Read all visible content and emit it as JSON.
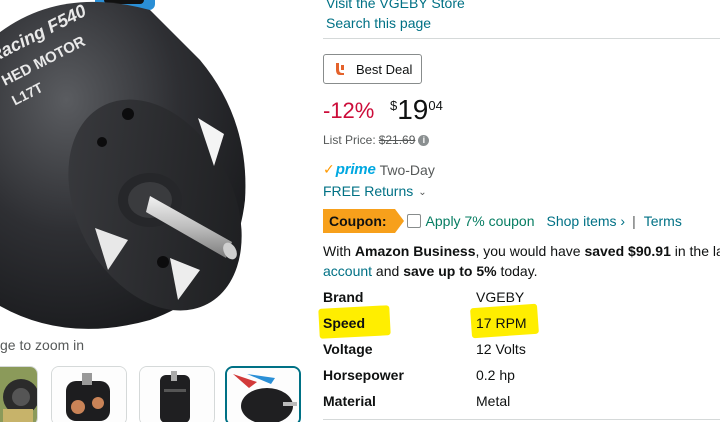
{
  "gallery": {
    "zoom_hint": "ge to zoom in",
    "thumbnails": [
      "thumb-action-shot",
      "thumb-motor-copper",
      "thumb-motor-side",
      "thumb-motor-front"
    ],
    "selected_thumbnail": 3
  },
  "store": {
    "visit_label": "Visit the VGEBY Store",
    "search_label": "Search this page"
  },
  "badge": {
    "best_deal": "Best Deal",
    "icon": "flame-icon"
  },
  "pricing": {
    "discount": "-12%",
    "currency": "$",
    "whole": "19",
    "fraction": "04",
    "list_price_label": "List Price:",
    "list_price_value": "$21.69",
    "info_icon": "info-icon"
  },
  "delivery": {
    "prime_check": "✓",
    "prime_label": "prime",
    "prime_speed": "Two-Day",
    "returns_label": "FREE Returns",
    "returns_icon": "chevron-down-icon"
  },
  "coupon": {
    "tag": "Coupon:",
    "apply_text": "Apply 7% coupon",
    "shop_items": "Shop items ›",
    "separator": "|",
    "terms": "Terms"
  },
  "business": {
    "prefix": "With ",
    "brand": "Amazon Business",
    "middle": ", you would have ",
    "saved": "saved $90.91",
    "suffix": " in the la",
    "account": "account",
    "and_text": " and ",
    "save_up": "save up to 5%",
    "today": " today."
  },
  "specs": [
    {
      "key": "Brand",
      "value": "VGEBY",
      "highlighted": false
    },
    {
      "key": "Speed",
      "value": "17 RPM",
      "highlighted": true
    },
    {
      "key": "Voltage",
      "value": "12 Volts",
      "highlighted": false
    },
    {
      "key": "Horsepower",
      "value": "0.2 hp",
      "highlighted": false
    },
    {
      "key": "Material",
      "value": "Metal",
      "highlighted": false
    }
  ],
  "colors": {
    "link": "#007185",
    "discount": "#cc0c39",
    "coupon_tag": "#f7a01b",
    "coupon_text": "#067d62",
    "prime": "#00a8e1",
    "highlight": "#ffee00"
  }
}
